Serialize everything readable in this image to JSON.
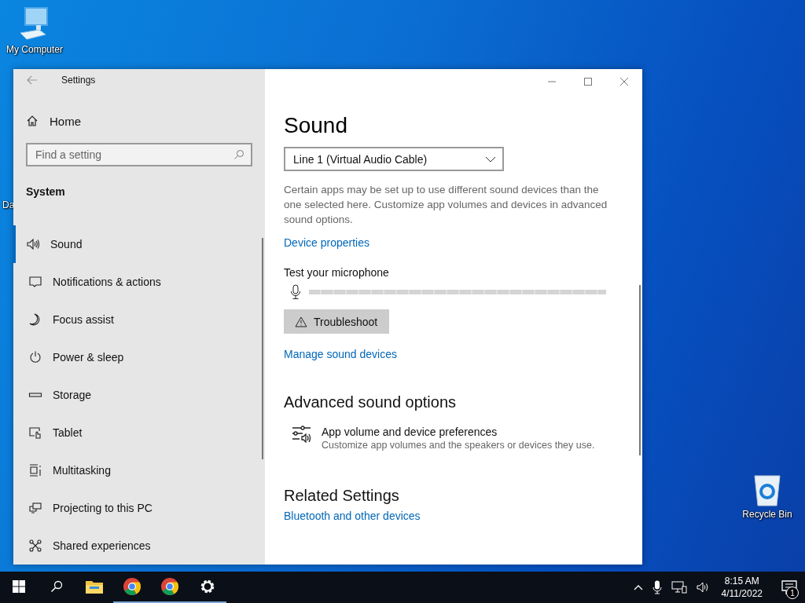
{
  "desktop_icons": [
    {
      "kind": "computer",
      "label": "My Computer"
    },
    {
      "kind": "partial",
      "label": "Da"
    },
    {
      "kind": "recycle",
      "label": "Recycle Bin"
    }
  ],
  "window": {
    "title": "Settings",
    "sidebar": {
      "home": "Home",
      "search": {
        "placeholder": "Find a setting"
      },
      "section": "System",
      "items": [
        {
          "kind": "sound",
          "label": "Sound",
          "selected": true
        },
        {
          "kind": "notifications",
          "label": "Notifications & actions",
          "selected": false
        },
        {
          "kind": "moon",
          "label": "Focus assist",
          "selected": false
        },
        {
          "kind": "power",
          "label": "Power & sleep",
          "selected": false
        },
        {
          "kind": "storage",
          "label": "Storage",
          "selected": false
        },
        {
          "kind": "tablet",
          "label": "Tablet",
          "selected": false
        },
        {
          "kind": "multitasking",
          "label": "Multitasking",
          "selected": false
        },
        {
          "kind": "projecting",
          "label": "Projecting to this PC",
          "selected": false
        },
        {
          "kind": "shared",
          "label": "Shared experiences",
          "selected": false
        }
      ]
    },
    "content": {
      "heading": "Sound",
      "input_device": "Line 1 (Virtual Audio Cable)",
      "note": "Certain apps may be set up to use different sound devices than the one selected here. Customize app volumes and devices in advanced sound options.",
      "device_properties_link": "Device properties",
      "test_label": "Test your microphone",
      "mic_meter": {
        "level": 0
      },
      "troubleshoot_button": "Troubleshoot",
      "manage_link": "Manage sound devices",
      "advanced_heading": "Advanced sound options",
      "advanced_item": {
        "title": "App volume and device preferences",
        "description": "Customize app volumes and the speakers or devices they use."
      },
      "related_heading": "Related Settings",
      "related_links": [
        "Bluetooth and other devices"
      ]
    }
  },
  "taskbar": {
    "apps": [
      {
        "kind": "explorer",
        "running": false
      },
      {
        "kind": "chrome",
        "running": true
      },
      {
        "kind": "chrome",
        "running": true
      },
      {
        "kind": "settings",
        "running": true
      }
    ],
    "clock": {
      "time": "8:15 AM",
      "date": "4/11/2022"
    },
    "notification_count": "1"
  }
}
